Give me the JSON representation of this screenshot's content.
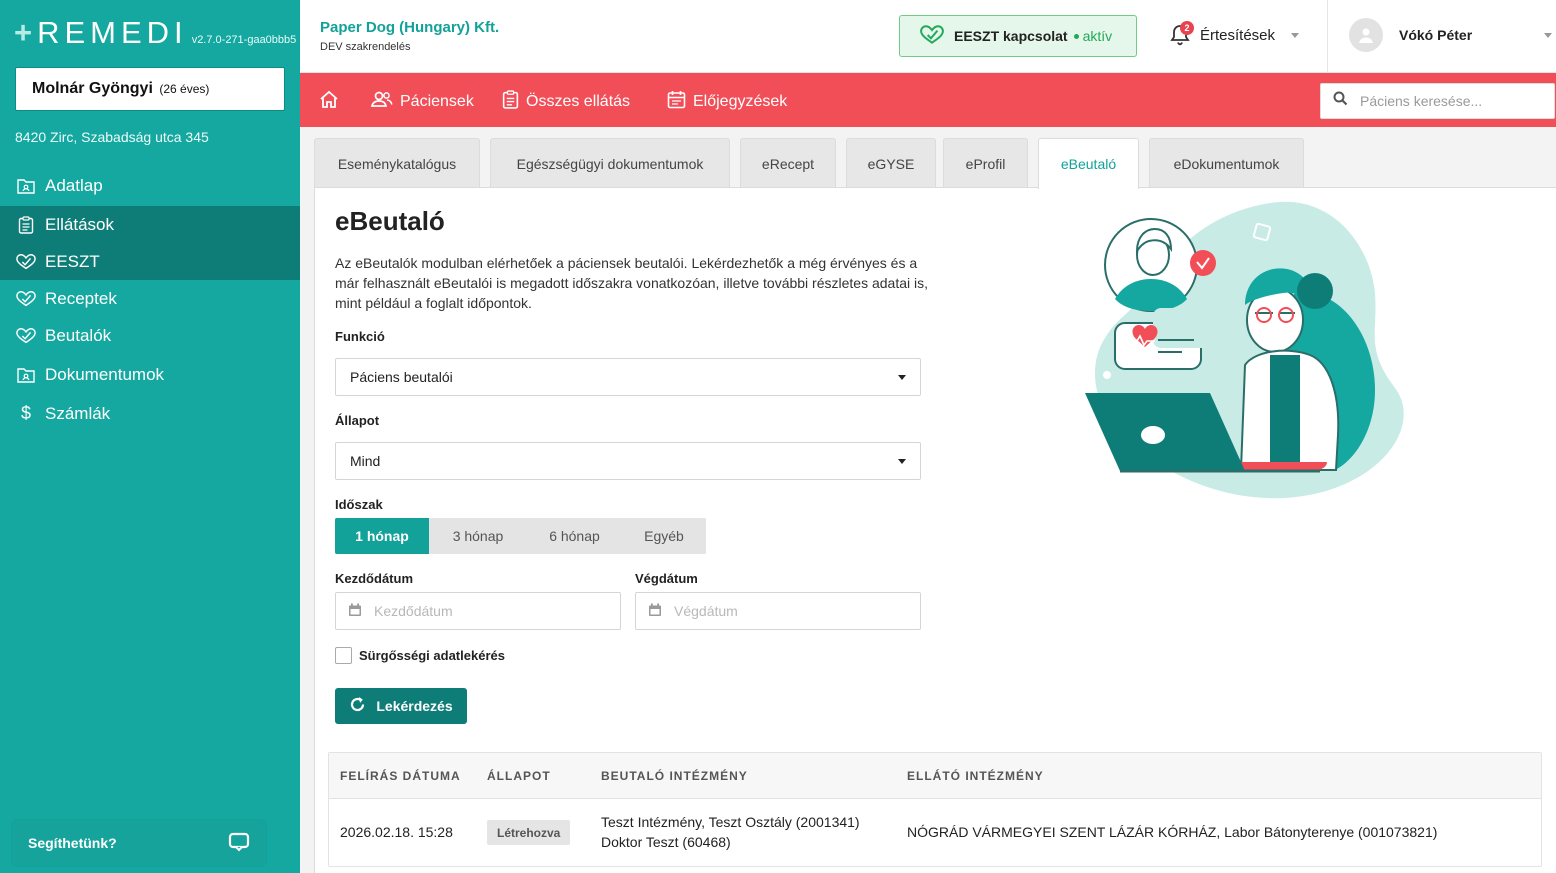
{
  "app": {
    "logo_text": "REMEDI",
    "version": "v2.7.0-271-gaa0bbb5"
  },
  "patient": {
    "name": "Molnár Gyöngyi",
    "age": "(26 éves)",
    "address": "8420 Zirc, Szabadság utca 345"
  },
  "sidebar": {
    "items": [
      {
        "label": "Adatlap",
        "icon": "folder-user-icon"
      },
      {
        "label": "Ellátások",
        "icon": "clipboard-icon"
      },
      {
        "label": "EESZT",
        "icon": "eeszt-icon"
      },
      {
        "label": "Receptek",
        "icon": "eeszt-icon"
      },
      {
        "label": "Beutalók",
        "icon": "eeszt-icon"
      },
      {
        "label": "Dokumentumok",
        "icon": "folder-user-icon"
      },
      {
        "label": "Számlák",
        "icon": "dollar-icon"
      }
    ],
    "help_label": "Segíthetünk?"
  },
  "header": {
    "org_name": "Paper Dog (Hungary) Kft.",
    "org_sub": "DEV szakrendelés",
    "eeszt_label": "EESZT kapcsolat",
    "eeszt_status": "aktív",
    "notifications_label": "Értesítések",
    "notifications_count": "2",
    "user_name": "Vókó Péter"
  },
  "topnav": {
    "items": [
      {
        "label": "Páciensek",
        "icon": "users-icon"
      },
      {
        "label": "Összes ellátás",
        "icon": "clipboard-icon"
      },
      {
        "label": "Előjegyzések",
        "icon": "calendar-icon"
      }
    ],
    "search_placeholder": "Páciens keresése..."
  },
  "tabs": [
    "Eseménykatalógus",
    "Egészségügyi dokumentumok",
    "eRecept",
    "eGYSE",
    "eProfil",
    "eBeutaló",
    "eDokumentumok"
  ],
  "active_tab": "eBeutaló",
  "main": {
    "title": "eBeutaló",
    "description": "Az eBeutalók modulban elérhetőek a páciensek beutalói. Lekérdezhetők a még érvényes és a már felhasznált eBeutalói is megadott időszakra vonatkozóan, illetve további részletes adatai is, mint például a foglalt időpontok.",
    "funkcio_label": "Funkció",
    "funkcio_value": "Páciens beutalói",
    "allapot_label": "Állapot",
    "allapot_value": "Mind",
    "idoszak_label": "Időszak",
    "idoszak_options": [
      "1 hónap",
      "3 hónap",
      "6 hónap",
      "Egyéb"
    ],
    "idoszak_selected": "1 hónap",
    "start_label": "Kezdődátum",
    "start_placeholder": "Kezdődátum",
    "end_label": "Végdátum",
    "end_placeholder": "Végdátum",
    "urgent_label": "Sürgősségi adatlekérés",
    "query_button": "Lekérdezés"
  },
  "table": {
    "headers": [
      "FELÍRÁS DÁTUMA",
      "ÁLLAPOT",
      "BEUTALÓ INTÉZMÉNY",
      "ELLÁTÓ INTÉZMÉNY"
    ],
    "rows": [
      {
        "date": "2026.02.18. 15:28",
        "status": "Létrehozva",
        "referrer_line1": "Teszt Intézmény, Teszt Osztály (2001341)",
        "referrer_line2": "Doktor Teszt (60468)",
        "provider": "NÓGRÁD VÁRMEGYEI SZENT LÁZÁR KÓRHÁZ, Labor Bátonyterenye (001073821)"
      }
    ]
  },
  "colors": {
    "sidebar": "#14a8a0",
    "sidebar_selected": "#0e7d77",
    "nav_red": "#f24e58",
    "accent": "#12a29a",
    "eeszt_bg": "#e5f7ea"
  }
}
